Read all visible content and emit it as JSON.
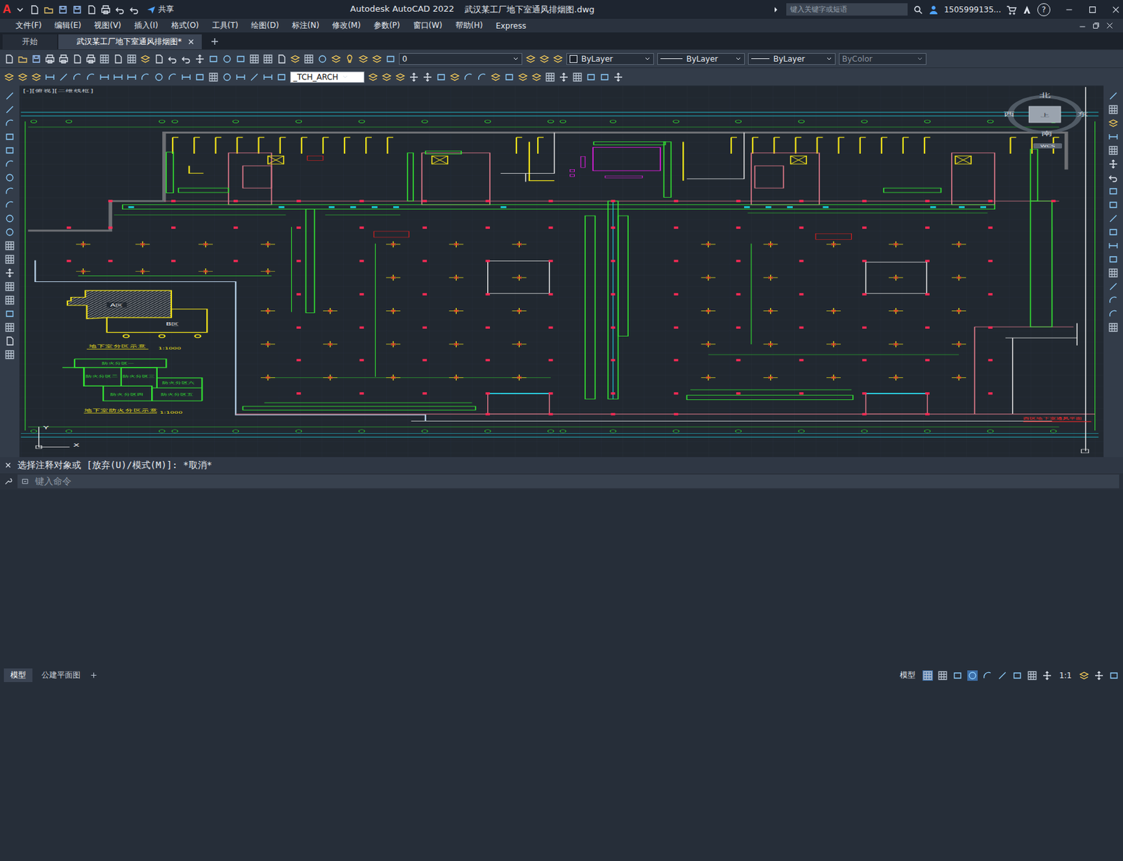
{
  "window": {
    "app_letter": "A",
    "share": "共享",
    "app": "Autodesk AutoCAD 2022",
    "file": "武汉某工厂地下室通风排烟图.dwg",
    "search_placeholder": "键入关键字或短语",
    "user": "1505999135...",
    "help": "?"
  },
  "menu": [
    "文件(F)",
    "编辑(E)",
    "视图(V)",
    "插入(I)",
    "格式(O)",
    "工具(T)",
    "绘图(D)",
    "标注(N)",
    "修改(M)",
    "参数(P)",
    "窗口(W)",
    "帮助(H)",
    "Express"
  ],
  "doc_tabs": [
    {
      "label": "开始",
      "selected": false
    },
    {
      "label": "武汉某工厂地下室通风排烟图*",
      "selected": true
    }
  ],
  "properties": {
    "layer": "0",
    "color": "ByLayer",
    "linetype": "ByLayer",
    "lineweight": "ByLayer",
    "plotstyle": {
      "label": "ByColor",
      "disabled": true
    }
  },
  "text_style": "_TCH_ARCH",
  "viewport": {
    "label": "[-][俯视][二维线框]",
    "compass": {
      "north": "北",
      "south": "南",
      "west": "西",
      "east": "东",
      "top": "上",
      "ucs": "WCS"
    },
    "ucs_axes": [
      "Y",
      "X"
    ]
  },
  "drawing": {
    "zone_title": "地下室分区示意",
    "zone_scale": "1:1000",
    "zones": [
      "A区",
      "B区"
    ],
    "fire_title": "地下室防火分区示意",
    "fire_scale": "1:1000",
    "fire_zones": [
      "防火分区一",
      "防火分区二",
      "防火分区三",
      "防火分区四",
      "防火分区五",
      "防火分区六"
    ],
    "plan_title": "西区地下室通风平面"
  },
  "command": {
    "history": "选择注释对象或 [放弃(U)/模式(M)]: *取消*",
    "placeholder": "键入命令"
  },
  "layout_tabs": [
    {
      "label": "模型",
      "selected": true
    },
    {
      "label": "公建平面图",
      "selected": false
    }
  ],
  "status": {
    "space": "模型",
    "scale": "1:1"
  }
}
